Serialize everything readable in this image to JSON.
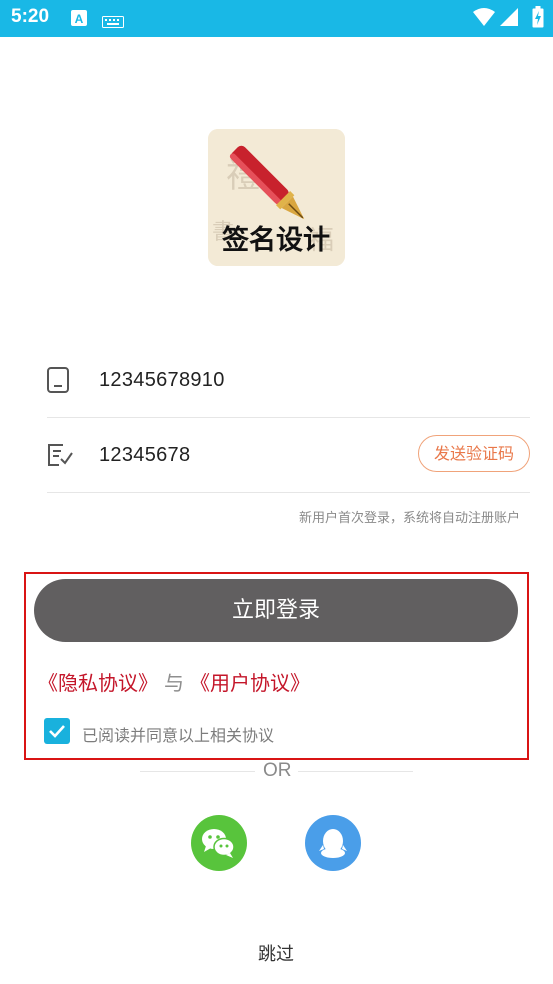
{
  "status_bar": {
    "time": "5:20",
    "icons": [
      "font-a-icon",
      "keyboard-icon",
      "wifi-icon",
      "signal-icon",
      "battery-charging-icon"
    ],
    "background": "#19b8e6"
  },
  "logo": {
    "alt": "签名设计",
    "icon": "fountain-pen-icon"
  },
  "form": {
    "phone": {
      "icon": "phone-icon",
      "value": "12345678910"
    },
    "code": {
      "icon": "verification-code-icon",
      "value": "12345678",
      "send_button": "发送验证码"
    },
    "hint": "新用户首次登录，系统将自动注册账户"
  },
  "login_button": "立即登录",
  "agreements": {
    "privacy": "《隐私协议》",
    "and": "与",
    "user": "《用户协议》"
  },
  "consent": {
    "checked": true,
    "label": "已阅读并同意以上相关协议"
  },
  "or_text": "OR",
  "social": {
    "wechat_icon": "wechat-icon",
    "qq_icon": "qq-icon"
  },
  "skip": "跳过",
  "colors": {
    "accent": "#19b8e6",
    "login_button": "#615f60",
    "link_red": "#c4162a",
    "code_orange": "#e9784a",
    "highlight": "#d91414",
    "wechat": "#58c43c",
    "qq": "#4a9ee9"
  }
}
